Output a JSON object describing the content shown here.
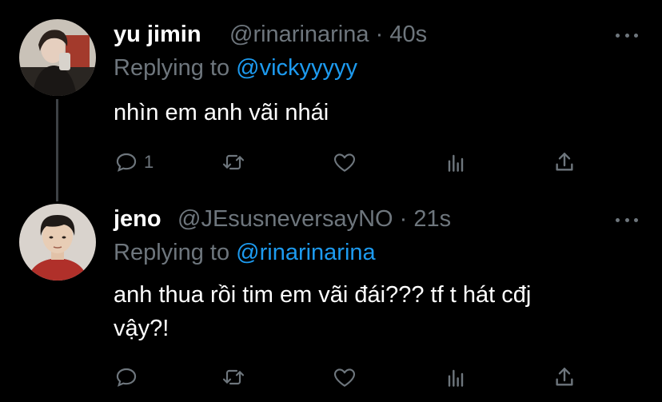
{
  "tweets": [
    {
      "display_name": "yu jimin",
      "handle": "@rinarinarina",
      "separator": "·",
      "time": "40s",
      "replying_prefix": "Replying to",
      "replying_to": "@vickyyyyy",
      "text": "nhìn em anh vãi nhái",
      "reply_count": "1",
      "retweet_count": "",
      "like_count": ""
    },
    {
      "display_name": "jeno",
      "handle": "@JEsusneversayNO",
      "separator": "·",
      "time": "21s",
      "replying_prefix": "Replying to",
      "replying_to": "@rinarinarina",
      "text": "anh thua rồi tim em vãi đái??? tf t hát cđj vậy?!",
      "reply_count": "",
      "retweet_count": "",
      "like_count": ""
    }
  ],
  "colors": {
    "background": "#000000",
    "text_primary": "#ffffff",
    "text_secondary": "#6e767d",
    "accent": "#1d9bf0",
    "thread_line": "#3d4145"
  },
  "icons": {
    "reply": "reply-icon",
    "retweet": "retweet-icon",
    "like": "like-icon",
    "analytics": "analytics-icon",
    "share": "share-icon",
    "more": "more-icon"
  }
}
